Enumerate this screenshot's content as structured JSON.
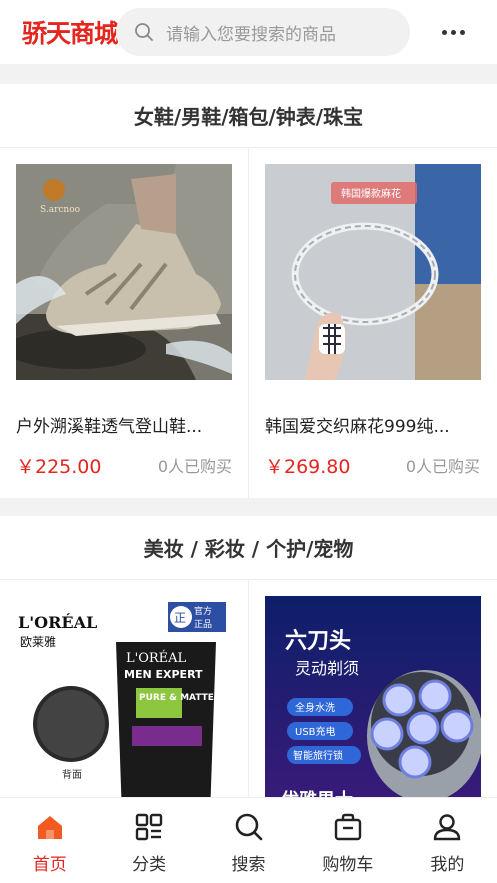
{
  "header": {
    "logo": "骄天商城",
    "search_placeholder": "请输入您要搜索的商品",
    "more_icon": "more-dots-icon"
  },
  "sections": [
    {
      "title": "女鞋/男鞋/箱包/钟表/珠宝",
      "products": [
        {
          "name": "户外溯溪鞋透气登山鞋...",
          "price": "￥225.00",
          "sold": "0人已购买",
          "image": "hiking-shoe-splash",
          "image_badge": "S.arcnoo"
        },
        {
          "name": "韩国爱交织麻花999纯...",
          "price": "￥269.80",
          "sold": "0人已购买",
          "image": "silver-twist-bangle",
          "image_badge": "韩国爆款麻花"
        }
      ]
    },
    {
      "title": "美妆 / 彩妆 / 个护/宠物",
      "products": [
        {
          "image": "loreal-men-expert-cleanser",
          "brand": "L'ORÉAL",
          "brand_cn": "欧莱雅",
          "official_badge": "官方正品",
          "badge_char": "正",
          "tube_brand": "L'ORÉAL",
          "tube_line": "MEN EXPERT",
          "tube_variant": "PURE & MATTE",
          "back_label": "背面"
        },
        {
          "image": "six-head-electric-shaver",
          "headline": "六刀头",
          "subheadline": "灵动剃须",
          "features": [
            "全身水洗",
            "USB充电",
            "智能旅行锁"
          ],
          "footer": "优雅男士"
        }
      ]
    }
  ],
  "nav": {
    "items": [
      {
        "label": "首页",
        "icon": "home-icon",
        "active": true
      },
      {
        "label": "分类",
        "icon": "category-grid-icon",
        "active": false
      },
      {
        "label": "搜索",
        "icon": "search-icon",
        "active": false
      },
      {
        "label": "购物车",
        "icon": "shopping-bag-icon",
        "active": false
      },
      {
        "label": "我的",
        "icon": "user-icon",
        "active": false
      }
    ]
  },
  "colors": {
    "brand": "#e4261f",
    "background": "#f2f2f2"
  }
}
